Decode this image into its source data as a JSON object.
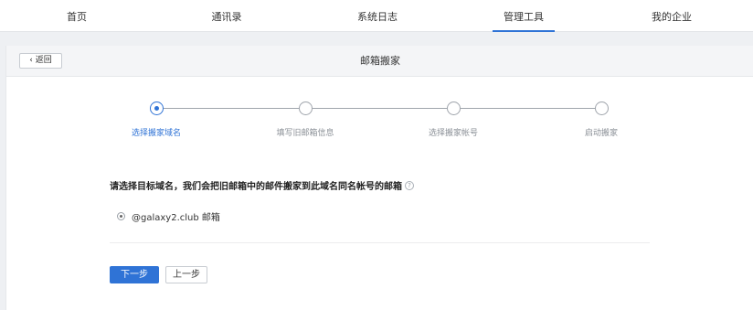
{
  "topnav": {
    "items": [
      {
        "label": "首页",
        "active": false
      },
      {
        "label": "通讯录",
        "active": false
      },
      {
        "label": "系统日志",
        "active": false
      },
      {
        "label": "管理工具",
        "active": true
      },
      {
        "label": "我的企业",
        "active": false
      }
    ]
  },
  "header": {
    "back_label": "返回",
    "title": "邮箱搬家"
  },
  "steps": [
    {
      "label": "选择搬家域名",
      "active": true
    },
    {
      "label": "填写旧邮箱信息",
      "active": false
    },
    {
      "label": "选择搬家帐号",
      "active": false
    },
    {
      "label": "启动搬家",
      "active": false
    }
  ],
  "form": {
    "question": "请选择目标域名，我们会把旧邮箱中的邮件搬家到此域名同名帐号的邮箱",
    "help_symbol": "?",
    "option_label": "@galaxy2.club 邮箱",
    "option_selected": true
  },
  "buttons": {
    "next_label": "下一步",
    "prev_label": "上一步"
  },
  "colors": {
    "accent": "#2f73d6"
  }
}
